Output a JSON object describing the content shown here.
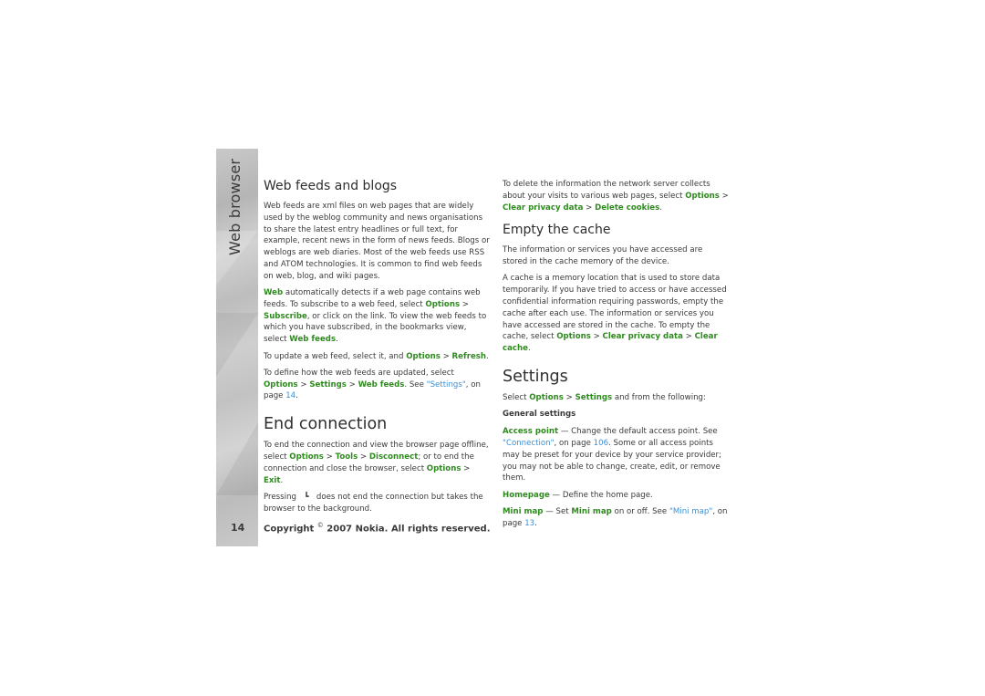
{
  "sidebar": {
    "section_title": "Web browser",
    "page_number": "14"
  },
  "footer": {
    "copyright_prefix": "Copyright",
    "copyright_symbol": "©",
    "copyright_suffix": "2007 Nokia. All rights reserved."
  },
  "col1": {
    "web_feeds": {
      "heading": "Web feeds and blogs",
      "p1": "Web feeds are xml files on web pages that are widely used by the weblog community and news organisations to share the latest entry headlines or full text, for example, recent news in the form of news feeds. Blogs or weblogs are web diaries. Most of the web feeds use RSS and ATOM technologies. It is common to find web feeds on web, blog, and wiki pages.",
      "p2": {
        "t1": "Web",
        "t2": " automatically detects if a web page contains web feeds. To subscribe to a web feed, select ",
        "t3": "Options",
        "t4": " > ",
        "t5": "Subscribe",
        "t6": ", or click on the link. To view the web feeds to which you have subscribed, in the bookmarks view, select ",
        "t7": "Web feeds",
        "t8": "."
      },
      "p3": {
        "t1": "To update a web feed, select it, and ",
        "t2": "Options",
        "t3": " > ",
        "t4": "Refresh",
        "t5": "."
      },
      "p4": {
        "t1": "To define how the web feeds are updated, select ",
        "t2": "Options",
        "t3": " > ",
        "t4": "Settings",
        "t5": " > ",
        "t6": "Web feeds",
        "t7": ". See ",
        "t8": "\"Settings\"",
        "t9": ", on page ",
        "t10": "14",
        "t11": "."
      }
    },
    "end_connection": {
      "heading": "End connection",
      "p1": {
        "t1": "To end the connection and view the browser page offline, select ",
        "t2": "Options",
        "t3": " > ",
        "t4": "Tools",
        "t5": " > ",
        "t6": "Disconnect",
        "t7": "; or to end the connection and close the browser, select ",
        "t8": "Options",
        "t9": " > ",
        "t10": "Exit",
        "t11": "."
      },
      "p2": {
        "t1": "Pressing",
        "icon_glyph": "⌐",
        "t2": "does not end the connection but takes the browser to the background."
      }
    }
  },
  "col2": {
    "intro": {
      "t1": "To delete the information the network server collects about your visits to various web pages, select ",
      "t2": "Options",
      "t3": " > ",
      "t4": "Clear privacy data",
      "t5": " > ",
      "t6": "Delete cookies",
      "t7": "."
    },
    "empty_cache": {
      "heading": "Empty the cache",
      "p1": "The information or services you have accessed are stored in the cache memory of the device.",
      "p2": {
        "t1": "A cache is a memory location that is used to store data temporarily. If you have tried to access or have accessed confidential information requiring passwords, empty the cache after each use. The information or services you have accessed are stored in the cache. To empty the cache, select ",
        "t2": "Options",
        "t3": " > ",
        "t4": "Clear privacy data",
        "t5": " > ",
        "t6": "Clear cache",
        "t7": "."
      }
    },
    "settings": {
      "heading": "Settings",
      "p1": {
        "t1": "Select ",
        "t2": "Options",
        "t3": " > ",
        "t4": "Settings",
        "t5": " and from the following:"
      },
      "subheading": "General settings",
      "access_point": {
        "t1": "Access point",
        "t2": " — Change the default access point. See ",
        "t3": "\"Connection\"",
        "t4": ", on page ",
        "t5": "106",
        "t6": ". Some or all access points may be preset for your device by your service provider; you may not be able to change, create, edit, or remove them."
      },
      "homepage": {
        "t1": "Homepage",
        "t2": " — Define the home page."
      },
      "mini_map": {
        "t1": "Mini map",
        "t2": " — Set ",
        "t3": "Mini map",
        "t4": " on or off. See ",
        "t5": "\"Mini map\"",
        "t6": ", on page ",
        "t7": "13",
        "t8": "."
      }
    }
  },
  "colors": {
    "menu_command": "#2f8a1f",
    "cross_reference": "#3b8fd6",
    "body_text": "#3a3a3a"
  }
}
